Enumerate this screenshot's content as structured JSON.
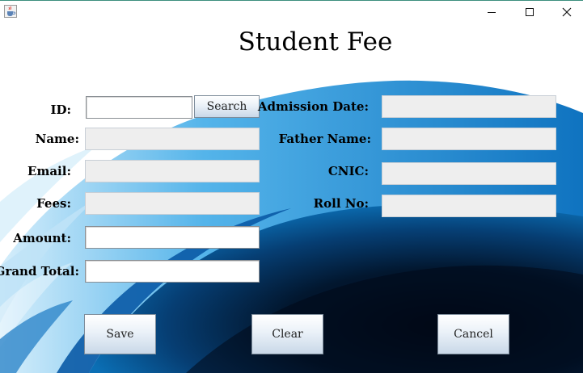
{
  "window": {
    "title": ""
  },
  "page": {
    "title": "Student Fee"
  },
  "form": {
    "id": {
      "label": "ID:",
      "value": ""
    },
    "search_button": "Search",
    "name": {
      "label": "Name:",
      "value": ""
    },
    "email": {
      "label": "Email:",
      "value": ""
    },
    "fees": {
      "label": "Fees:",
      "value": ""
    },
    "amount": {
      "label": "Amount:",
      "value": ""
    },
    "grand_total": {
      "label": "Grand Total:",
      "value": ""
    },
    "admission_date": {
      "label": "Admission Date:",
      "value": ""
    },
    "father_name": {
      "label": "Father Name:",
      "value": ""
    },
    "cnic": {
      "label": "CNIC:",
      "value": ""
    },
    "roll_no": {
      "label": "Roll No:",
      "value": ""
    }
  },
  "actions": {
    "save": "Save",
    "clear": "Clear",
    "cancel": "Cancel"
  },
  "icons": {
    "app": "java-cup-icon",
    "minimize": "minimize-icon",
    "maximize": "maximize-icon",
    "close": "close-icon"
  },
  "colors": {
    "background_wave": "#1f7fc4",
    "readonly_field": "#eeeeee",
    "button_gradient_end": "#c9d8e8"
  }
}
